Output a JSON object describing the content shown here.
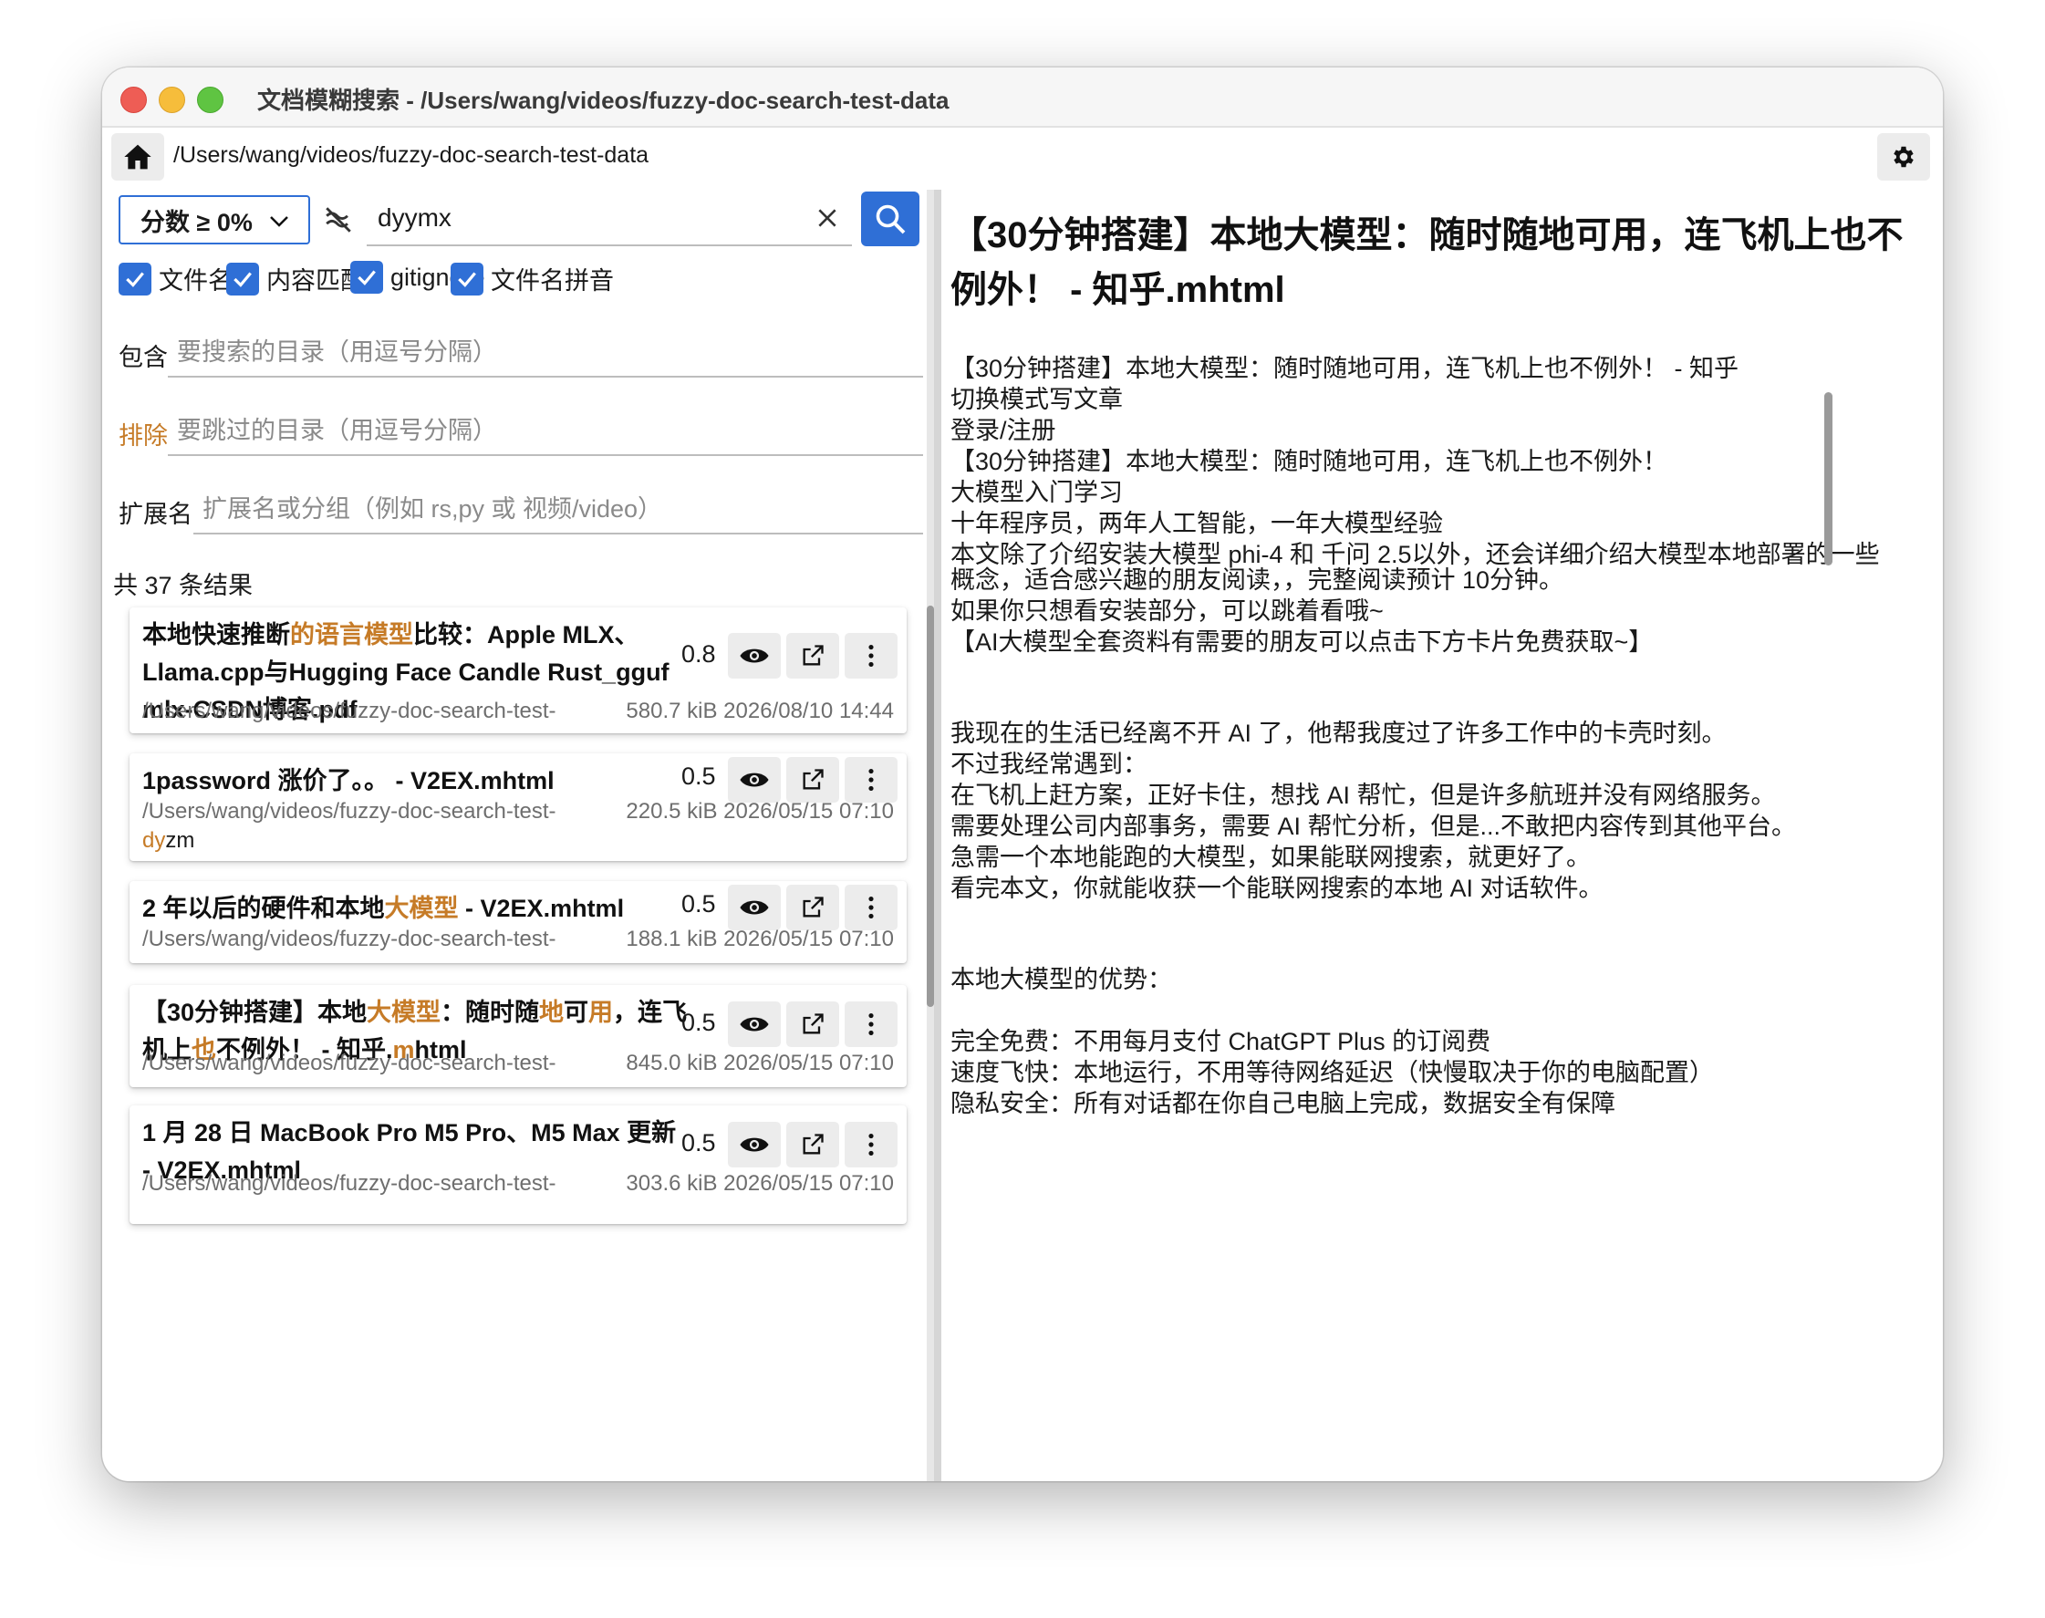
{
  "window": {
    "title": "文档模糊搜索 - /Users/wang/videos/fuzzy-doc-search-test-data"
  },
  "toolbar": {
    "path": "/Users/wang/videos/fuzzy-doc-search-test-data"
  },
  "search": {
    "score_filter": "分数 ≥ 0%",
    "query": "dyymx",
    "options": [
      "文件名",
      "内容匹配",
      "gitignore",
      "文件名拼音"
    ]
  },
  "filters": {
    "include_label": "包含",
    "include_placeholder": "要搜索的目录（用逗号分隔）",
    "exclude_label": "排除",
    "exclude_placeholder": "要跳过的目录（用逗号分隔）",
    "ext_label": "扩展名",
    "ext_placeholder": "扩展名或分组（例如 rs,py 或 视频/video）"
  },
  "results_count": "共 37 条结果",
  "results": [
    {
      "title": [
        [
          "本地快速推断",
          false
        ],
        [
          "的语言模型",
          true
        ],
        [
          "比较：Apple MLX、Llama.cpp与Hugging Face Candle Rust_gguf mlx-CSDN博客.pdf",
          false
        ]
      ],
      "score": "0.8",
      "path": "/Users/wang/videos/fuzzy-doc-search-test-",
      "meta": "580.7 kiB 2026/08/10 14:44"
    },
    {
      "title": [
        [
          "1password 涨价了。。 - V2EX.mhtml",
          false
        ]
      ],
      "score": "0.5",
      "path": "/Users/wang/videos/fuzzy-doc-search-test-",
      "meta": "220.5 kiB 2026/05/15 07:10",
      "match": [
        [
          "dy",
          true
        ],
        [
          "zm",
          false
        ]
      ]
    },
    {
      "title": [
        [
          "2 年以后的硬件和本地",
          false
        ],
        [
          "大模型",
          true
        ],
        [
          " - V2EX.mhtml",
          false
        ]
      ],
      "score": "0.5",
      "path": "/Users/wang/videos/fuzzy-doc-search-test-",
      "meta": "188.1 kiB 2026/05/15 07:10"
    },
    {
      "title": [
        [
          "【30分钟搭建】本地",
          false
        ],
        [
          "大模型",
          true
        ],
        [
          "：随时随",
          false
        ],
        [
          "地",
          true
        ],
        [
          "可",
          false
        ],
        [
          "用",
          true
        ],
        [
          "，连飞机上",
          false
        ],
        [
          "也",
          true
        ],
        [
          "不例外！ - 知乎.",
          false
        ],
        [
          "m",
          true
        ],
        [
          "html",
          false
        ]
      ],
      "score": "0.5",
      "path": "/Users/wang/videos/fuzzy-doc-search-test-",
      "meta": "845.0 kiB 2026/05/15 07:10"
    },
    {
      "title": [
        [
          "1 月 28 日 MacBook Pro M5 Pro、M5 Max 更新 - V2EX.mhtml",
          false
        ]
      ],
      "score": "0.5",
      "path": "/Users/wang/videos/fuzzy-doc-search-test-",
      "meta": "303.6 kiB 2026/05/15 07:10"
    }
  ],
  "preview": {
    "title": "【30分钟搭建】本地大模型：随时随地可用，连飞机上也不例外！ - 知乎.mhtml",
    "lines": [
      "【30分钟搭建】本地大模型：随时随地可用，连飞机上也不例外！ - 知乎",
      "切换模式写文章",
      "登录/注册",
      "【30分钟搭建】本地大模型：随时随地可用，连飞机上也不例外！",
      "大模型入门学习",
      "十年程序员，两年人工智能，一年大模型经验",
      "本文除了介绍安装大模型 phi-4 和 千问 2.5以外，还会详细介绍大模型本地部署的一些",
      "概念，适合感兴趣的朋友阅读，，完整阅读预计 10分钟。",
      "如果你只想看安装部分，可以跳着看哦~",
      "【AI大模型全套资料有需要的朋友可以点击下方卡片免费获取~】",
      "我现在的生活已经离不开 AI 了，他帮我度过了许多工作中的卡壳时刻。",
      "不过我经常遇到：",
      "在飞机上赶方案，正好卡住，想找 AI 帮忙，但是许多航班并没有网络服务。",
      "需要处理公司内部事务，需要 AI 帮忙分析，但是...不敢把内容传到其他平台。",
      "急需一个本地能跑的大模型，如果能联网搜索，就更好了。",
      "看完本文，你就能收获一个能联网搜索的本地 AI 对话软件。",
      "本地大模型的优势：",
      "完全免费：不用每月支付 ChatGPT Plus 的订阅费",
      "速度飞快：本地运行，不用等待网络延迟（快慢取决于你的电脑配置）",
      "隐私安全：所有对话都在你自己电脑上完成，数据安全有保障"
    ]
  }
}
